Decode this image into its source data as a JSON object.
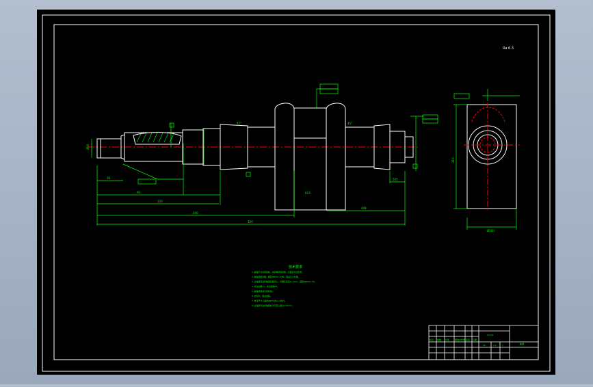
{
  "colors": {
    "background": "#000000",
    "frame": "#ffffff",
    "geometry": "#ffffff",
    "dimension": "#00ff00",
    "centerline": "#ff0000",
    "viewport": "#a9b6c8"
  },
  "drawing": {
    "roughness_note": "Ra 6.3",
    "tech_title": "技术要求",
    "tech_requirements": [
      "1. 曲轴不允许有裂纹、夹渣等铸造缺陷，表面应光洁平整。",
      "2. 曲轴调质处理，硬度HB241~286，锻后正火处理。",
      "3. 主轴颈及连杆轴颈表面淬火，淬硬层深度2~3mm，硬度HRC50~55。",
      "4. 未注倒角C1，未注圆角R2。",
      "5. 曲轴须经动平衡检验。",
      "6. 去毛刺，锐边倒钝。",
      "7. 未注尺寸公差按GB/T1804-m执行。",
      "8. 主轴颈与连杆轴颈的平行度公差为0.02mm。"
    ],
    "dimensions": {
      "flange_dia": "Ø50",
      "lengths": [
        "36",
        "95",
        "120",
        "200",
        "320",
        "448",
        "505"
      ],
      "angles": [
        "45°",
        "45°"
      ],
      "fillet": "R15",
      "side_width": "Ø150",
      "side_height": "210"
    }
  },
  "title_block": {
    "drawing_no": "CQ-01",
    "name": "曲轴",
    "material": "45",
    "scale": "1:1",
    "sheet": "1",
    "row_labels": [
      "标记",
      "处数",
      "分区",
      "更改文件号",
      "签名",
      "日期"
    ]
  }
}
